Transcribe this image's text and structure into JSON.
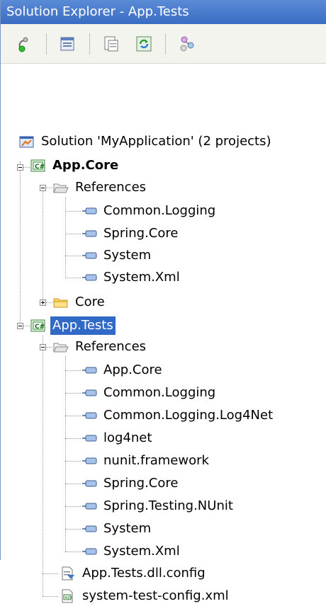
{
  "window": {
    "title": "Solution Explorer - App.Tests"
  },
  "toolbar": {
    "buttons": [
      {
        "icon": "properties-icon"
      },
      {
        "icon": "show-all-files-icon"
      },
      {
        "icon": "view-designer-icon"
      },
      {
        "icon": "refresh-icon"
      },
      {
        "icon": "class-view-icon"
      }
    ]
  },
  "tree": {
    "solution": "Solution 'MyApplication' (2 projects)",
    "core_project": {
      "name": "App.Core",
      "references_label": "References",
      "references": [
        "Common.Logging",
        "Spring.Core",
        "System",
        "System.Xml"
      ],
      "folder": "Core"
    },
    "tests_project": {
      "name": "App.Tests",
      "references_label": "References",
      "references": [
        "App.Core",
        "Common.Logging",
        "Common.Logging.Log4Net",
        "log4net",
        "nunit.framework",
        "Spring.Core",
        "Spring.Testing.NUnit",
        "System",
        "System.Xml"
      ],
      "files": [
        "App.Tests.dll.config",
        "system-test-config.xml"
      ]
    }
  },
  "colors": {
    "title_bar": "#3a6cc3",
    "selection": "#3169c6",
    "toolbar_bg": "#f4f4ef"
  }
}
